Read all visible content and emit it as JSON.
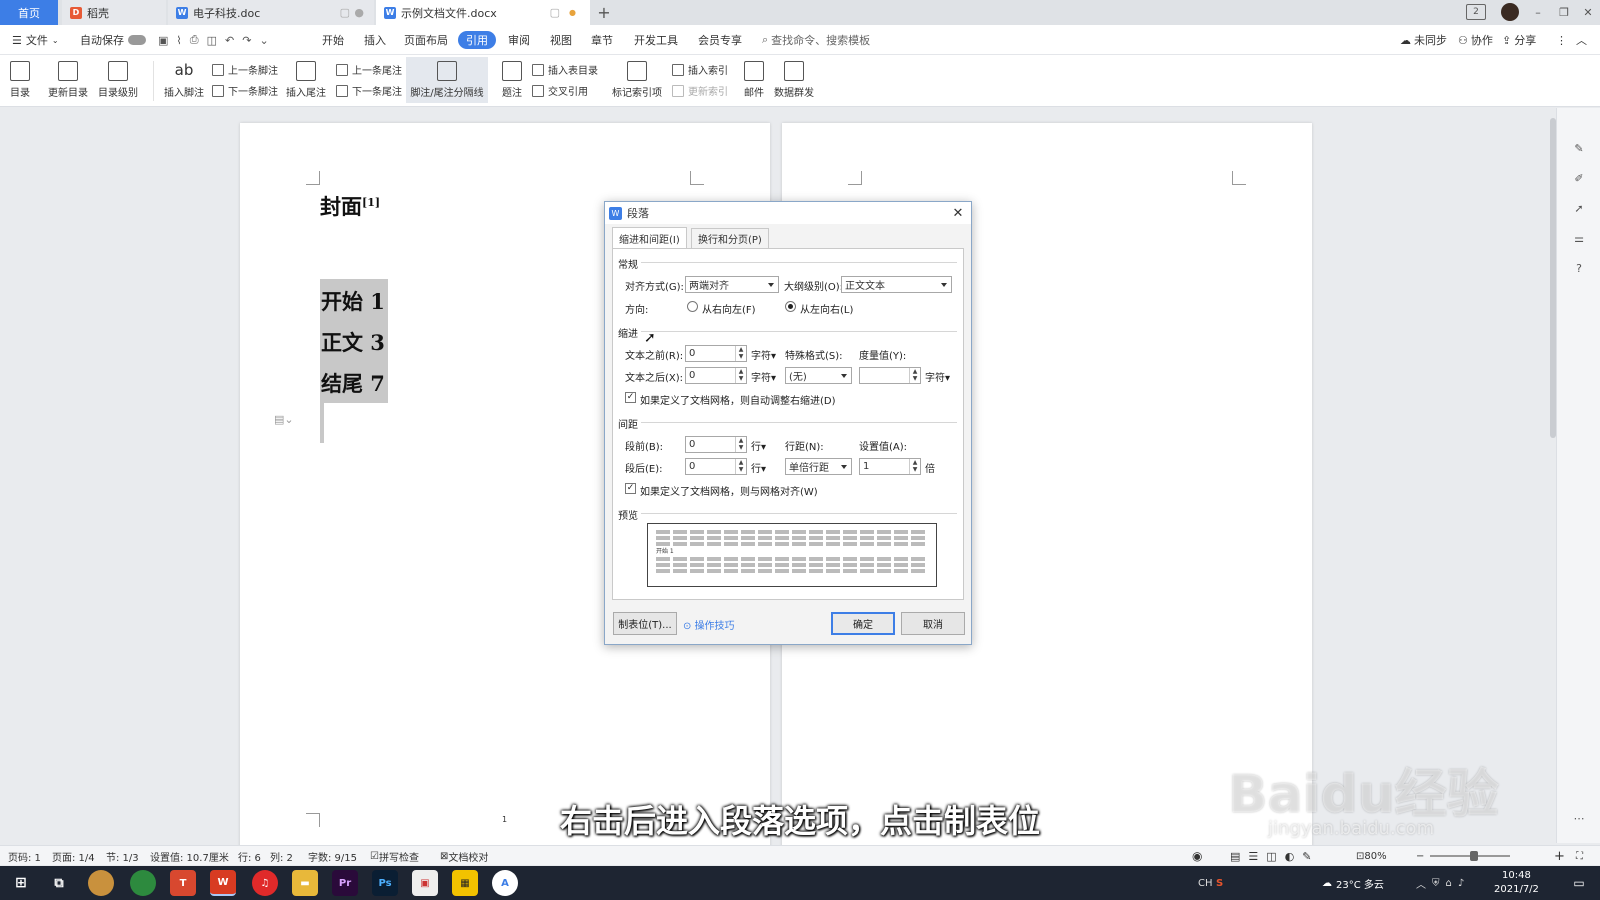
{
  "tabs": [
    {
      "label": "首页"
    },
    {
      "label": "稻壳",
      "icon": "docer-icon"
    },
    {
      "label": "电子科技.doc",
      "icon": "word-doc-icon"
    },
    {
      "label": "示例文档文件.docx",
      "icon": "word-doc-icon"
    }
  ],
  "menu": {
    "file": "文件",
    "autosave": "自动保存",
    "items": [
      "开始",
      "插入",
      "页面布局",
      "引用",
      "审阅",
      "视图",
      "章节",
      "开发工具",
      "会员专享"
    ],
    "selected": "引用",
    "search_placeholder": "查找命令、搜索模板",
    "unsynced": "未同步",
    "collab": "协作",
    "share": "分享"
  },
  "ribbon": {
    "toc": "目录",
    "update_toc": "更新目录",
    "toc_level": "目录级别",
    "insert_footnote": "插入脚注",
    "prev_footnote": "上一条脚注",
    "next_footnote": "下一条脚注",
    "insert_endnote": "插入尾注",
    "prev_endnote": "上一条尾注",
    "next_endnote": "下一条尾注",
    "separator": "脚注/尾注分隔线",
    "caption": "题注",
    "insert_table_of_figures": "插入表目录",
    "cross_ref": "交叉引用",
    "mark_entry": "标记索引项",
    "insert_index": "插入索引",
    "update_index": "更新索引",
    "mail": "邮件",
    "mass_send": "数据群发"
  },
  "document": {
    "heading": "封面",
    "heading_sup": "[1]",
    "lines": [
      "开始 1",
      "正文 3",
      "结尾 7"
    ],
    "page_number": "1"
  },
  "dialog": {
    "title": "段落",
    "tabs": [
      "缩进和间距(I)",
      "换行和分页(P)"
    ],
    "general": "常规",
    "align_label": "对齐方式(G):",
    "align_value": "两端对齐",
    "outline_label": "大纲级别(O):",
    "outline_value": "正文文本",
    "direction_label": "方向:",
    "rtl": "从右向左(F)",
    "ltr": "从左向右(L)",
    "indent": "缩进",
    "before_text_label": "文本之前(R):",
    "before_text_value": "0",
    "after_text_label": "文本之后(X):",
    "after_text_value": "0",
    "unit_char": "字符",
    "special_label": "特殊格式(S):",
    "special_value": "(无)",
    "measure_label": "度量值(Y):",
    "measure_value": "",
    "auto_indent": "如果定义了文档网格，则自动调整右缩进(D)",
    "spacing": "间距",
    "space_before_label": "段前(B):",
    "space_before_value": "0",
    "space_after_label": "段后(E):",
    "space_after_value": "0",
    "unit_line": "行",
    "line_spacing_label": "行距(N):",
    "line_spacing_value": "单倍行距",
    "set_value_label": "设置值(A):",
    "set_value_value": "1",
    "unit_times": "倍",
    "grid_align": "如果定义了文档网格，则与网格对齐(W)",
    "preview": "预览",
    "preview_text": "开始 1",
    "tabs_button": "制表位(T)...",
    "tips": "操作技巧",
    "ok": "确定",
    "cancel": "取消"
  },
  "subtitle": "右击后进入段落选项，点击制表位",
  "watermark": "Baidu经验",
  "watermark_url": "jingyan.baidu.com",
  "status": {
    "page_no": "页码: 1",
    "pages": "页面: 1/4",
    "section": "节: 1/3",
    "setting": "设置值: 10.7厘米",
    "row": "行: 6",
    "col": "列: 2",
    "words": "字数: 9/15",
    "spell": "拼写检查",
    "proof": "文档校对",
    "zoom": "80%"
  },
  "taskbar": {
    "weather": "23°C 多云",
    "time": "10:48",
    "date": "2021/7/2",
    "ime": "CH"
  },
  "colors": {
    "accent": "#3d7ee6",
    "taskbar": "#1e2532"
  }
}
